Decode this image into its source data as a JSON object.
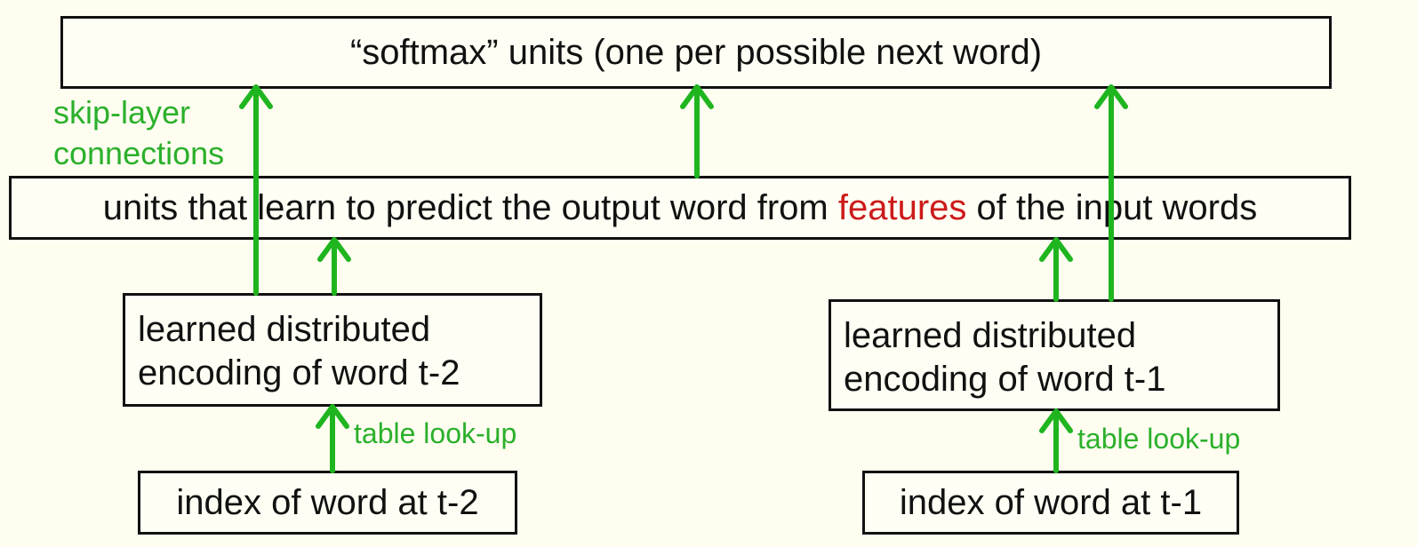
{
  "boxes": {
    "softmax": "“softmax” units (one per possible next word)",
    "hidden": {
      "before": "units that learn to predict the output word from ",
      "highlight": "features",
      "after": " of the input words"
    },
    "enc_t2": {
      "line1": "learned distributed",
      "line2": "encoding of word t-2"
    },
    "enc_t1": {
      "line1": "learned distributed",
      "line2": "encoding of word t-1"
    },
    "index_t2": "index of word at t-2",
    "index_t1": "index of word at t-1"
  },
  "labels": {
    "skip_line1": "skip-layer",
    "skip_line2": "connections",
    "lookup_left": "table look-up",
    "lookup_right": "table look-up"
  },
  "colors": {
    "arrow": "#1fb51f",
    "label": "#2bb02b",
    "highlight": "#cc1a1a",
    "border": "#111111",
    "background": "#fefdf0"
  }
}
